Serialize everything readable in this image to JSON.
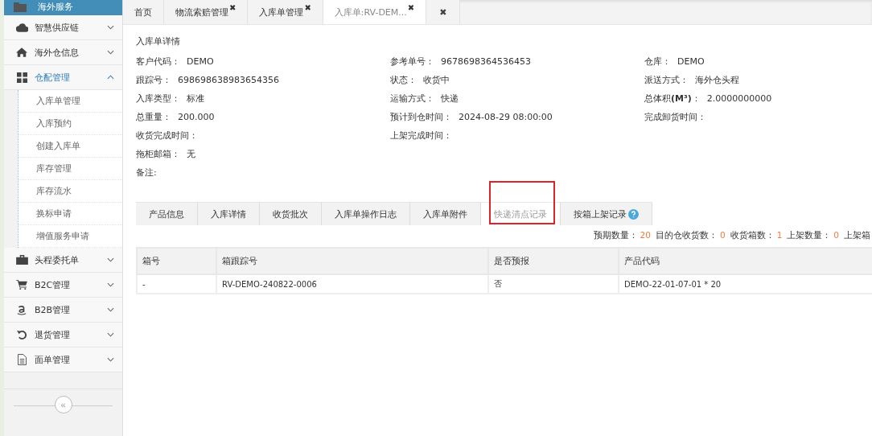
{
  "sidebar": {
    "header": {
      "label": "海外服务"
    },
    "groups": [
      {
        "label": "智慧供应链",
        "expanded": false,
        "selected": false
      },
      {
        "label": "海外仓信息",
        "expanded": false,
        "selected": false
      },
      {
        "label": "仓配管理",
        "expanded": true,
        "selected": true,
        "children": [
          {
            "label": "入库单管理"
          },
          {
            "label": "入库预约"
          },
          {
            "label": "创建入库单"
          },
          {
            "label": "库存管理"
          },
          {
            "label": "库存流水"
          },
          {
            "label": "换标申请"
          },
          {
            "label": "增值服务申请"
          }
        ]
      },
      {
        "label": "头程委托单",
        "expanded": false,
        "selected": false
      },
      {
        "label": "B2C管理",
        "expanded": false,
        "selected": false
      },
      {
        "label": "B2B管理",
        "expanded": false,
        "selected": false
      },
      {
        "label": "退货管理",
        "expanded": false,
        "selected": false
      },
      {
        "label": "面单管理",
        "expanded": false,
        "selected": false
      }
    ],
    "collapse_button": "«"
  },
  "tabs": [
    {
      "label": "首页",
      "closable": false,
      "selected": false
    },
    {
      "label": "物流索赔管理",
      "closable": true,
      "selected": false
    },
    {
      "label": "入库单管理",
      "closable": true,
      "selected": false
    },
    {
      "label": "入库单:RV-DEM...",
      "closable": true,
      "selected": true
    }
  ],
  "close_all": "✖",
  "close_mark": "✖",
  "detail": {
    "title": "入库单详情",
    "columns": [
      [
        {
          "label": "客户代码：",
          "value": "DEMO"
        },
        {
          "label": "跟踪号：",
          "value": "698698638983654356"
        },
        {
          "label": "入库类型：",
          "value": "标准"
        },
        {
          "label": "总重量：",
          "value": "200.000"
        },
        {
          "label": "收货完成时间："
        },
        {
          "label": "拖柜邮箱：",
          "value": "无"
        },
        {
          "label": "备注:"
        }
      ],
      [
        {
          "label": "参考单号：",
          "value": "9678698364536453"
        },
        {
          "label": "状态：",
          "value": "收货中"
        },
        {
          "label": "运输方式：",
          "value": "快递"
        },
        {
          "label": "预计到仓时间：",
          "value": "2024-08-29 08:00:00"
        },
        {
          "label": "上架完成时间："
        }
      ],
      [
        {
          "label": "仓库：",
          "value": "DEMO"
        },
        {
          "label": "派送方式：",
          "value": "海外仓头程"
        },
        {
          "label": "总体积**(M³)**：",
          "value": "2.0000000000"
        },
        {
          "label": "完成卸货时间："
        }
      ]
    ]
  },
  "detail_tabs": [
    {
      "label": "产品信息",
      "selected": false,
      "highlighted": false,
      "help": false
    },
    {
      "label": "入库详情",
      "selected": false,
      "highlighted": false,
      "help": false
    },
    {
      "label": "收货批次",
      "selected": false,
      "highlighted": false,
      "help": false
    },
    {
      "label": "入库单操作日志",
      "selected": false,
      "highlighted": false,
      "help": false
    },
    {
      "label": "入库单附件",
      "selected": false,
      "highlighted": false,
      "help": false
    },
    {
      "label": "快递清点记录",
      "selected": true,
      "highlighted": true,
      "help": false
    },
    {
      "label": "按箱上架记录",
      "selected": false,
      "highlighted": false,
      "help": true
    }
  ],
  "summary": [
    {
      "label": "预期数量：",
      "value": "20"
    },
    {
      "label": "目的仓收货数：",
      "value": "0"
    },
    {
      "label": "收货箱数：",
      "value": "1"
    },
    {
      "label": "上架数量：",
      "value": "0"
    },
    {
      "label": "上架箱"
    }
  ],
  "table": {
    "columns": [
      "箱号",
      "箱跟踪号",
      "是否预报",
      "产品代码"
    ],
    "rows": [
      [
        "-",
        "RV-DEMO-240822-0006",
        "否",
        "DEMO-22-01-07-01 * 20"
      ]
    ]
  }
}
